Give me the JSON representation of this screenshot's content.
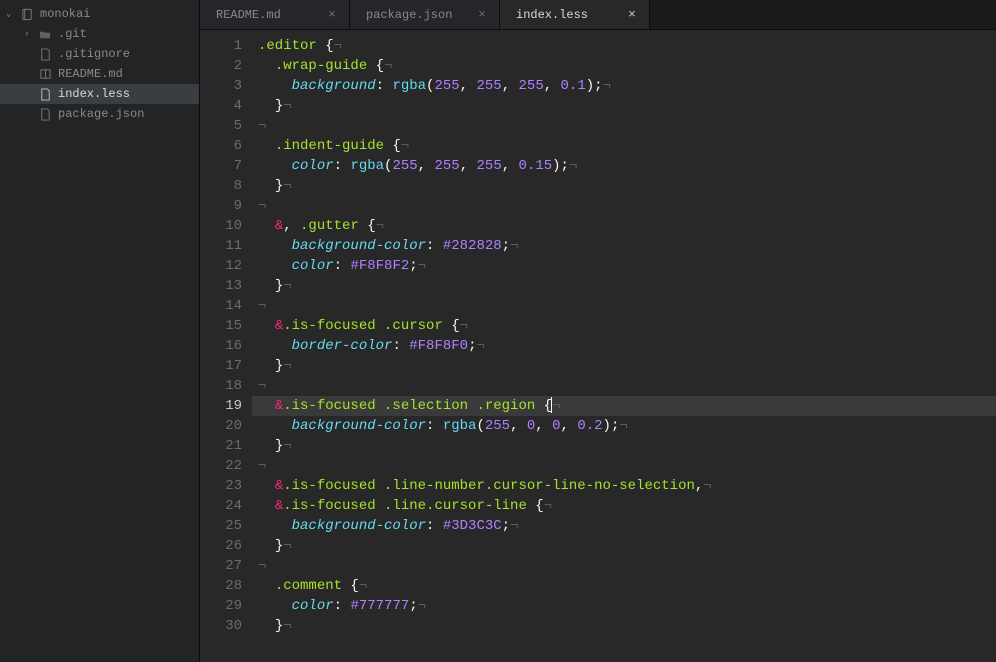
{
  "project": {
    "name": "monokai"
  },
  "tree": {
    "root": "monokai",
    "items": [
      {
        "label": ".git",
        "type": "folder"
      },
      {
        "label": ".gitignore",
        "type": "file"
      },
      {
        "label": "README.md",
        "type": "markdown"
      },
      {
        "label": "index.less",
        "type": "file",
        "selected": true
      },
      {
        "label": "package.json",
        "type": "file"
      }
    ]
  },
  "tabs": [
    {
      "label": "README.md",
      "active": false,
      "close": "×"
    },
    {
      "label": "package.json",
      "active": false,
      "close": "×"
    },
    {
      "label": "index.less",
      "active": true,
      "close": "×"
    }
  ],
  "glyphs": {
    "nl": "¬",
    "arrow_down": "⌄",
    "arrow_right": "›"
  },
  "current_line": 19,
  "code_lines": [
    [
      [
        "sel",
        ".editor"
      ],
      [
        "punc",
        " {"
      ],
      [
        "inv",
        "¬"
      ]
    ],
    [
      [
        "sp",
        "  "
      ],
      [
        "sel",
        ".wrap-guide"
      ],
      [
        "punc",
        " {"
      ],
      [
        "inv",
        "¬"
      ]
    ],
    [
      [
        "sp",
        "    "
      ],
      [
        "prop",
        "background"
      ],
      [
        "punc",
        ": "
      ],
      [
        "func",
        "rgba"
      ],
      [
        "punc",
        "("
      ],
      [
        "num",
        "255"
      ],
      [
        "punc",
        ", "
      ],
      [
        "num",
        "255"
      ],
      [
        "punc",
        ", "
      ],
      [
        "num",
        "255"
      ],
      [
        "punc",
        ", "
      ],
      [
        "num",
        "0.1"
      ],
      [
        "punc",
        ");"
      ],
      [
        "inv",
        "¬"
      ]
    ],
    [
      [
        "sp",
        "  "
      ],
      [
        "punc",
        "}"
      ],
      [
        "inv",
        "¬"
      ]
    ],
    [
      [
        "inv",
        "¬"
      ]
    ],
    [
      [
        "sp",
        "  "
      ],
      [
        "sel",
        ".indent-guide"
      ],
      [
        "punc",
        " {"
      ],
      [
        "inv",
        "¬"
      ]
    ],
    [
      [
        "sp",
        "    "
      ],
      [
        "prop",
        "color"
      ],
      [
        "punc",
        ": "
      ],
      [
        "func",
        "rgba"
      ],
      [
        "punc",
        "("
      ],
      [
        "num",
        "255"
      ],
      [
        "punc",
        ", "
      ],
      [
        "num",
        "255"
      ],
      [
        "punc",
        ", "
      ],
      [
        "num",
        "255"
      ],
      [
        "punc",
        ", "
      ],
      [
        "num",
        "0.15"
      ],
      [
        "punc",
        ");"
      ],
      [
        "inv",
        "¬"
      ]
    ],
    [
      [
        "sp",
        "  "
      ],
      [
        "punc",
        "}"
      ],
      [
        "inv",
        "¬"
      ]
    ],
    [
      [
        "inv",
        "¬"
      ]
    ],
    [
      [
        "sp",
        "  "
      ],
      [
        "op",
        "&"
      ],
      [
        "punc",
        ", "
      ],
      [
        "sel",
        ".gutter"
      ],
      [
        "punc",
        " {"
      ],
      [
        "inv",
        "¬"
      ]
    ],
    [
      [
        "sp",
        "    "
      ],
      [
        "prop",
        "background-color"
      ],
      [
        "punc",
        ": "
      ],
      [
        "hex",
        "#282828"
      ],
      [
        "punc",
        ";"
      ],
      [
        "inv",
        "¬"
      ]
    ],
    [
      [
        "sp",
        "    "
      ],
      [
        "prop",
        "color"
      ],
      [
        "punc",
        ": "
      ],
      [
        "hex",
        "#F8F8F2"
      ],
      [
        "punc",
        ";"
      ],
      [
        "inv",
        "¬"
      ]
    ],
    [
      [
        "sp",
        "  "
      ],
      [
        "punc",
        "}"
      ],
      [
        "inv",
        "¬"
      ]
    ],
    [
      [
        "inv",
        "¬"
      ]
    ],
    [
      [
        "sp",
        "  "
      ],
      [
        "op",
        "&"
      ],
      [
        "sel",
        ".is-focused .cursor"
      ],
      [
        "punc",
        " {"
      ],
      [
        "inv",
        "¬"
      ]
    ],
    [
      [
        "sp",
        "    "
      ],
      [
        "prop",
        "border-color"
      ],
      [
        "punc",
        ": "
      ],
      [
        "hex",
        "#F8F8F0"
      ],
      [
        "punc",
        ";"
      ],
      [
        "inv",
        "¬"
      ]
    ],
    [
      [
        "sp",
        "  "
      ],
      [
        "punc",
        "}"
      ],
      [
        "inv",
        "¬"
      ]
    ],
    [
      [
        "inv",
        "¬"
      ]
    ],
    [
      [
        "sp",
        "  "
      ],
      [
        "op",
        "&"
      ],
      [
        "sel",
        ".is-focused .selection .region"
      ],
      [
        "punc",
        " {"
      ],
      [
        "cursor",
        ""
      ],
      [
        "inv",
        "¬"
      ]
    ],
    [
      [
        "sp",
        "    "
      ],
      [
        "prop",
        "background-color"
      ],
      [
        "punc",
        ": "
      ],
      [
        "func",
        "rgba"
      ],
      [
        "punc",
        "("
      ],
      [
        "num",
        "255"
      ],
      [
        "punc",
        ", "
      ],
      [
        "num",
        "0"
      ],
      [
        "punc",
        ", "
      ],
      [
        "num",
        "0"
      ],
      [
        "punc",
        ", "
      ],
      [
        "num",
        "0.2"
      ],
      [
        "punc",
        ");"
      ],
      [
        "inv",
        "¬"
      ]
    ],
    [
      [
        "sp",
        "  "
      ],
      [
        "punc",
        "}"
      ],
      [
        "inv",
        "¬"
      ]
    ],
    [
      [
        "inv",
        "¬"
      ]
    ],
    [
      [
        "sp",
        "  "
      ],
      [
        "op",
        "&"
      ],
      [
        "sel",
        ".is-focused .line-number.cursor-line-no-selection"
      ],
      [
        "punc",
        ","
      ],
      [
        "inv",
        "¬"
      ]
    ],
    [
      [
        "sp",
        "  "
      ],
      [
        "op",
        "&"
      ],
      [
        "sel",
        ".is-focused .line.cursor-line"
      ],
      [
        "punc",
        " {"
      ],
      [
        "inv",
        "¬"
      ]
    ],
    [
      [
        "sp",
        "    "
      ],
      [
        "prop",
        "background-color"
      ],
      [
        "punc",
        ": "
      ],
      [
        "hex",
        "#3D3C3C"
      ],
      [
        "punc",
        ";"
      ],
      [
        "inv",
        "¬"
      ]
    ],
    [
      [
        "sp",
        "  "
      ],
      [
        "punc",
        "}"
      ],
      [
        "inv",
        "¬"
      ]
    ],
    [
      [
        "inv",
        "¬"
      ]
    ],
    [
      [
        "sp",
        "  "
      ],
      [
        "sel",
        ".comment"
      ],
      [
        "punc",
        " {"
      ],
      [
        "inv",
        "¬"
      ]
    ],
    [
      [
        "sp",
        "    "
      ],
      [
        "prop",
        "color"
      ],
      [
        "punc",
        ": "
      ],
      [
        "hex",
        "#777777"
      ],
      [
        "punc",
        ";"
      ],
      [
        "inv",
        "¬"
      ]
    ],
    [
      [
        "sp",
        "  "
      ],
      [
        "punc",
        "}"
      ],
      [
        "inv",
        "¬"
      ]
    ]
  ]
}
